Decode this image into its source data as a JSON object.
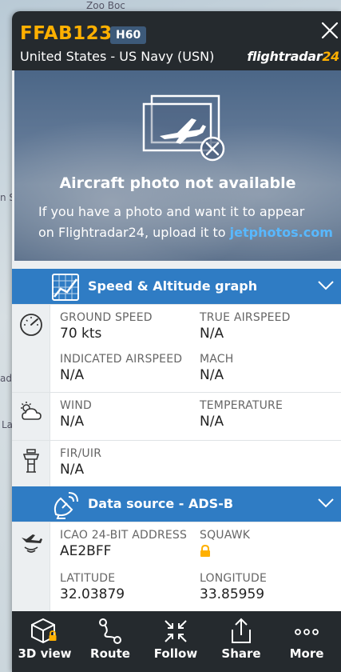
{
  "map": {
    "labels": [
      "Zoo Boc",
      "n S",
      "ad",
      "La"
    ]
  },
  "header": {
    "callsign": "FFAB123",
    "aircraft_type": "H60",
    "airline": "United States - US Navy (USN)",
    "brand_text": "flightradar",
    "brand_number": "24"
  },
  "photo": {
    "title": "Aircraft photo not available",
    "desc_line1": "If you have a photo and want it to appear",
    "desc_line2": "on Flightradar24, upload it to ",
    "link_text": "jetphotos.com"
  },
  "speed_section": {
    "title": "Speed & Altitude graph",
    "ground_speed_label": "GROUND SPEED",
    "ground_speed_value": "70 kts",
    "true_airspeed_label": "TRUE AIRSPEED",
    "true_airspeed_value": "N/A",
    "indicated_airspeed_label": "INDICATED AIRSPEED",
    "indicated_airspeed_value": "N/A",
    "mach_label": "MACH",
    "mach_value": "N/A",
    "wind_label": "WIND",
    "wind_value": "N/A",
    "temperature_label": "TEMPERATURE",
    "temperature_value": "N/A",
    "fir_label": "FIR/UIR",
    "fir_value": "N/A"
  },
  "source_section": {
    "title": "Data source - ADS-B",
    "icao_label": "ICAO 24-BIT ADDRESS",
    "icao_value": "AE2BFF",
    "squawk_label": "SQUAWK",
    "latitude_label": "LATITUDE",
    "latitude_value": "32.03879",
    "longitude_label": "LONGITUDE",
    "longitude_value": "33.85959"
  },
  "toolbar": {
    "view3d": "3D view",
    "route": "Route",
    "follow": "Follow",
    "share": "Share",
    "more": "More"
  },
  "colors": {
    "accent_yellow": "#ffb000",
    "section_blue": "#2f7cc4",
    "header_dark": "#252a2e",
    "link_blue": "#58b8ff"
  }
}
